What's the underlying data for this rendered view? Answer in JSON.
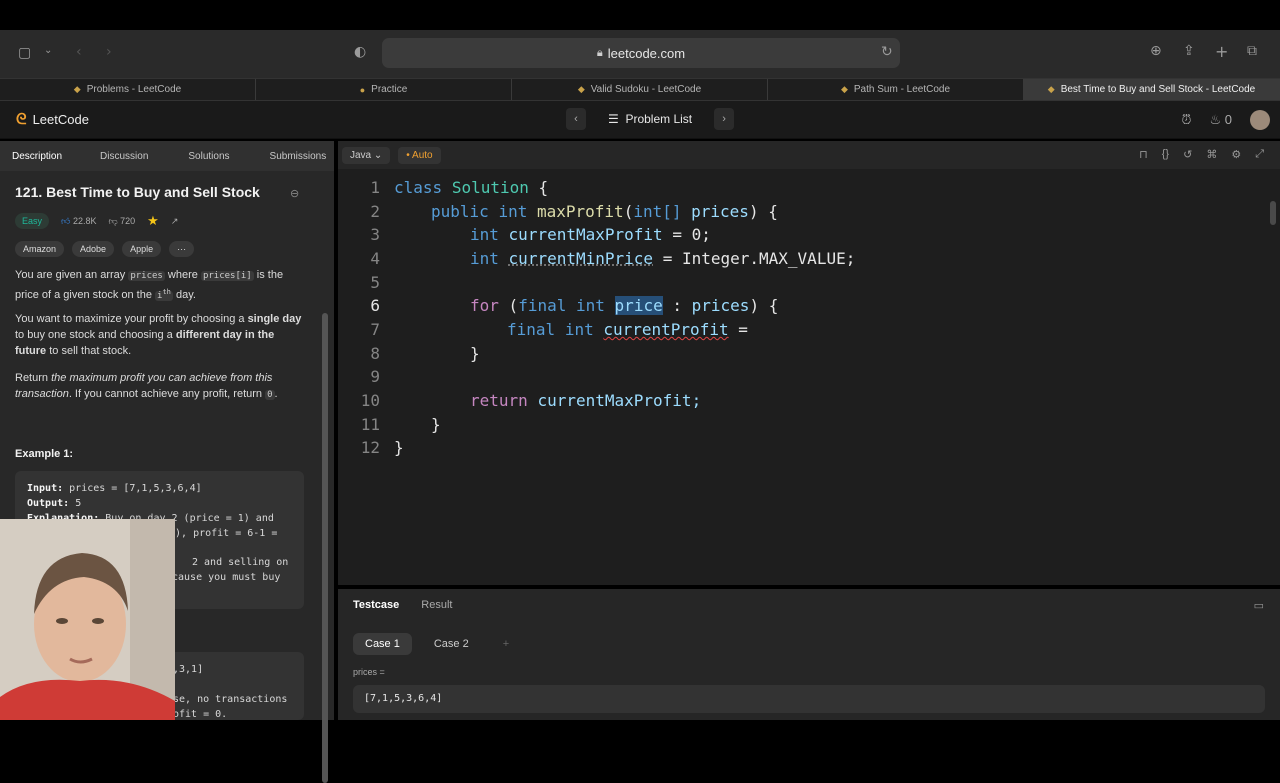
{
  "browser": {
    "url": "leetcode.com",
    "tabs": [
      {
        "label": "Problems - LeetCode",
        "active": false
      },
      {
        "label": "Practice",
        "active": false
      },
      {
        "label": "Valid Sudoku - LeetCode",
        "active": false
      },
      {
        "label": "Path Sum - LeetCode",
        "active": false
      },
      {
        "label": "Best Time to Buy and Sell Stock - LeetCode",
        "active": true
      }
    ]
  },
  "header": {
    "logo_text": "LeetCode",
    "problem_list": "Problem List",
    "streak": "0"
  },
  "left": {
    "tabs": [
      "Description",
      "Discussion",
      "Solutions",
      "Submissions"
    ],
    "title": "121. Best Time to Buy and Sell Stock",
    "difficulty": "Easy",
    "likes": "22.8K",
    "dislikes": "720",
    "companies": [
      "Amazon",
      "Adobe",
      "Apple",
      "···"
    ],
    "p1_a": "You are given an array",
    "p1_code1": "prices",
    "p1_b": "where",
    "p1_code2": "prices[i]",
    "p1_c": "is the price of a given stock on the",
    "p1_i": "i",
    "p1_th": "th",
    "p1_d": "day.",
    "p2_a": "You want to maximize your profit by choosing a",
    "p2_b1": "single day",
    "p2_c": "to buy one stock and choosing a",
    "p2_b2": "different day in the future",
    "p2_d": "to sell that stock.",
    "p3_a": "Return",
    "p3_i": "the maximum profit you can achieve from this transaction",
    "p3_b": ". If you cannot achieve any profit, return",
    "p3_code": "0",
    "p3_c": ".",
    "example1_title": "Example 1:",
    "example1": {
      "input_label": "Input:",
      "input": "prices = [7,1,5,3,6,4]",
      "output_label": "Output:",
      "output": "5",
      "expl_label": "Explanation:",
      "expl1": "Buy on day 2 (price = 1) and",
      "expl2": "6), profit = 6-1 =",
      "expl3": "2 and selling on",
      "expl4": "cause you must buy"
    },
    "example2_partial": {
      "l1": ",3,1]",
      "l2": "se, no transactions",
      "l3": "ofit = 0."
    }
  },
  "editor": {
    "language": "Java",
    "mode": "Auto",
    "lines": [
      "1",
      "2",
      "3",
      "4",
      "5",
      "6",
      "7",
      "8",
      "9",
      "10",
      "11",
      "12"
    ],
    "current_line": 6,
    "code": {
      "l1_kw": "class",
      "l1_name": "Solution",
      "l1_end": "{",
      "l2_kw1": "public",
      "l2_kw2": "int",
      "l2_fn": "maxProfit",
      "l2_p1": "(",
      "l2_t": "int[]",
      "l2_arg": "prices",
      "l2_end": ") {",
      "l3_t": "int",
      "l3_var": "currentMaxProfit",
      "l3_rest": "= 0;",
      "l4_t": "int",
      "l4_var": "currentMinPrice",
      "l4_rest": "= Integer.MAX_VALUE;",
      "l6_kw": "for",
      "l6_p": "(",
      "l6_f": "final",
      "l6_t": "int",
      "l6_var": "price",
      "l6_colon": ":",
      "l6_arr": "prices",
      "l6_end": ") {",
      "l7_f": "final",
      "l7_t": "int",
      "l7_var": "currentProfit",
      "l7_rest": "=",
      "l8": "}",
      "l10_kw": "return",
      "l10_rest": "currentMaxProfit;",
      "l11": "}",
      "l12": "}"
    }
  },
  "bottom": {
    "tabs": [
      "Testcase",
      "Result"
    ],
    "cases": [
      "Case 1",
      "Case 2",
      "+"
    ],
    "param_label": "prices =",
    "param_value": "[7,1,5,3,6,4]"
  }
}
